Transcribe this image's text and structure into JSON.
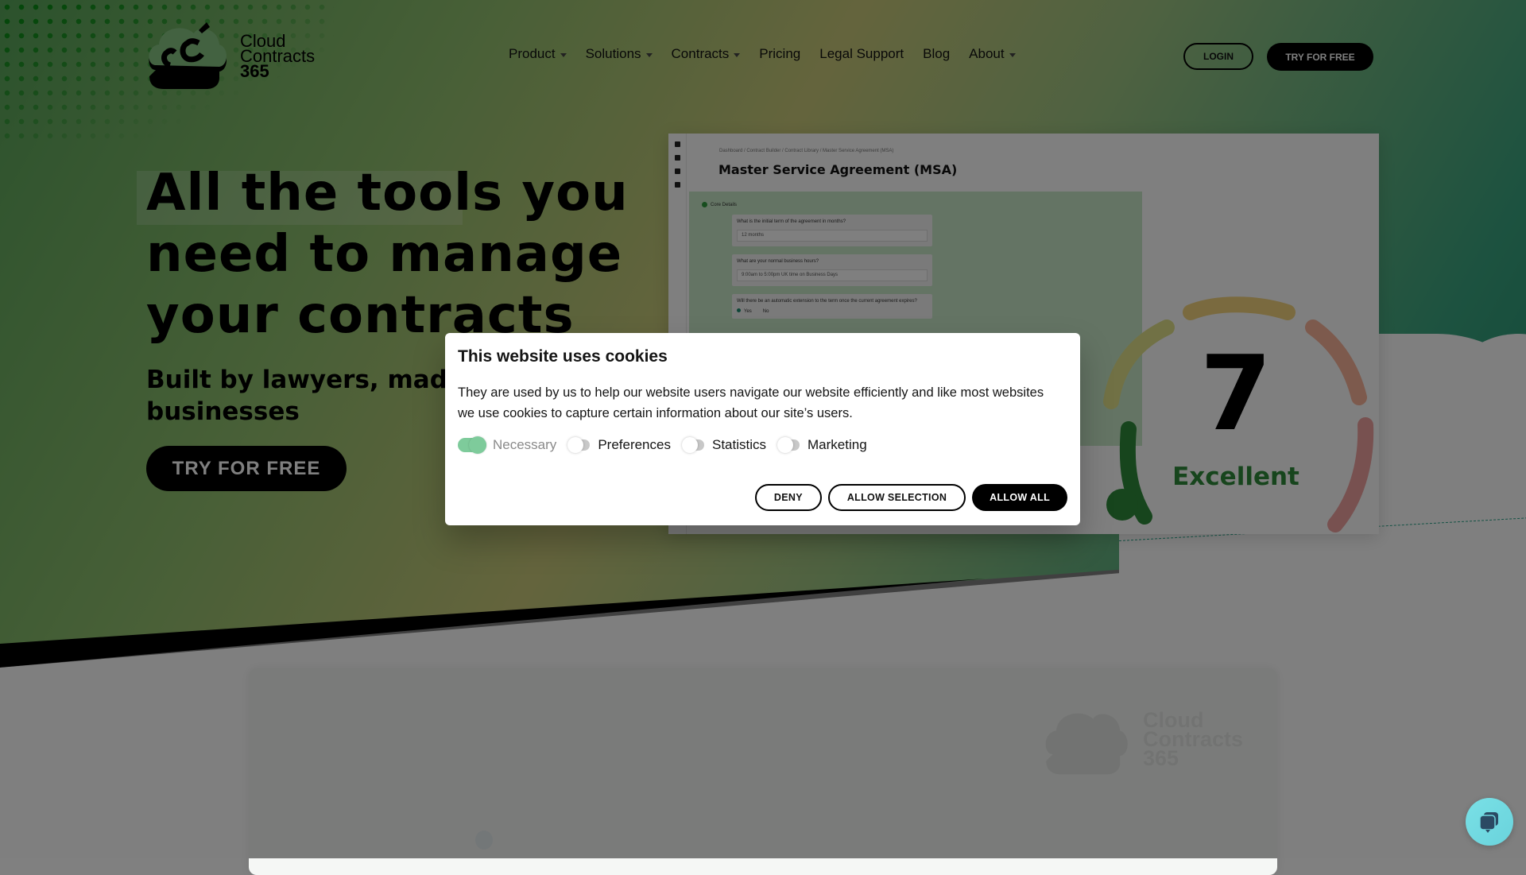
{
  "brand": {
    "line1": "Cloud",
    "line2": "Contracts",
    "line3": "365"
  },
  "nav": {
    "items": [
      {
        "label": "Product",
        "dropdown": true
      },
      {
        "label": "Solutions",
        "dropdown": true
      },
      {
        "label": "Contracts",
        "dropdown": true
      },
      {
        "label": "Pricing",
        "dropdown": false
      },
      {
        "label": "Legal Support",
        "dropdown": false
      },
      {
        "label": "Blog",
        "dropdown": false
      },
      {
        "label": "About",
        "dropdown": true
      }
    ],
    "login_label": "LOGIN",
    "try_label": "TRY FOR FREE"
  },
  "hero": {
    "headline_lines": [
      "All the tools  you",
      "need to manage",
      "your contracts"
    ],
    "subheading_lines": [
      "Built by lawyers, made",
      "businesses"
    ],
    "cta_label": "TRY FOR FREE"
  },
  "mockup": {
    "breadcrumb": "Dashboard  /  Contract Builder  /  Contract Library  /  Master Service Agreement (MSA)",
    "title": "Master Service Agreement (MSA)",
    "step_label": "Core Details",
    "questions": [
      {
        "label": "What is the initial term of the agreement in months?",
        "value": "12 months"
      },
      {
        "label": "What are your normal business hours?",
        "value": "9:00am to 5:00pm UK time on Business Days"
      },
      {
        "label": "Will there be an automatic extension to the term once the current agreement expires?",
        "options": [
          "Yes",
          "No"
        ],
        "selected": "Yes"
      }
    ]
  },
  "gauge": {
    "score": "7",
    "rating": "Excellent",
    "colors": {
      "green": "#2f8a3a",
      "yellow": "#c9bd5a",
      "gold": "#e0c25a",
      "orange": "#e08a6a",
      "red": "#c96a6a"
    }
  },
  "cookie_dialog": {
    "title": "This website uses cookies",
    "body": "They are used by us to help our website users navigate our website efficiently and like most websites we use cookies to capture certain information about our site’s users.",
    "toggles": [
      {
        "label": "Necessary",
        "on": true,
        "disabled": true
      },
      {
        "label": "Preferences",
        "on": false,
        "disabled": false
      },
      {
        "label": "Statistics",
        "on": false,
        "disabled": false
      },
      {
        "label": "Marketing",
        "on": false,
        "disabled": false
      }
    ],
    "buttons": {
      "deny": "DENY",
      "allow_selection": "ALLOW SELECTION",
      "allow_all": "ALLOW ALL"
    }
  },
  "chat": {
    "icon": "chat-bubble-icon"
  }
}
